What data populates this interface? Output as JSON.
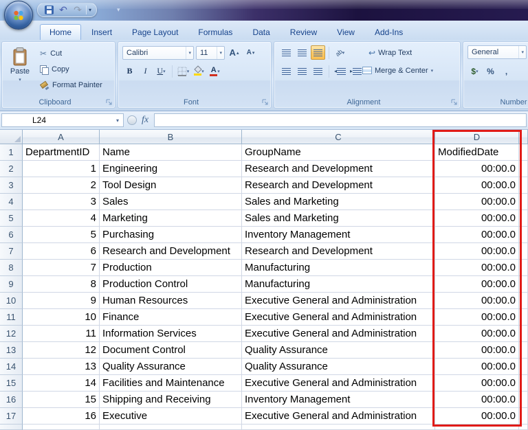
{
  "icons": {
    "dropdown": "▾",
    "undo": "↶",
    "redo": "↷",
    "scissors": "✂",
    "up_triangle": "▴",
    "down_triangle": "▾",
    "wrap_arrow": "↩",
    "orientation": "ab",
    "left_caret": "◂",
    "right_caret": "▸"
  },
  "ribbon": {
    "tabs": [
      {
        "label": "Home",
        "active": true
      },
      {
        "label": "Insert",
        "active": false
      },
      {
        "label": "Page Layout",
        "active": false
      },
      {
        "label": "Formulas",
        "active": false
      },
      {
        "label": "Data",
        "active": false
      },
      {
        "label": "Review",
        "active": false
      },
      {
        "label": "View",
        "active": false
      },
      {
        "label": "Add-Ins",
        "active": false
      }
    ],
    "clipboard": {
      "label": "Clipboard",
      "paste": "Paste",
      "cut": "Cut",
      "copy": "Copy",
      "format_painter": "Format Painter"
    },
    "font": {
      "label": "Font",
      "font_name": "Calibri",
      "font_size": "11",
      "bold": "B",
      "italic": "I",
      "underline": "U",
      "grow": "A",
      "shrink": "A",
      "color_letter": "A"
    },
    "alignment": {
      "label": "Alignment",
      "wrap_text": "Wrap Text",
      "merge_center": "Merge & Center"
    },
    "number": {
      "label": "Number",
      "format": "General",
      "currency": "$",
      "percent": "%",
      "comma": ","
    }
  },
  "formula_bar": {
    "name_box": "L24",
    "fx": "fx"
  },
  "grid": {
    "column_letters": [
      "A",
      "B",
      "C",
      "D"
    ],
    "highlighted_column": "D",
    "rows": [
      {
        "n": 1,
        "cells": [
          "DepartmentID",
          "Name",
          "GroupName",
          "ModifiedDate"
        ]
      },
      {
        "n": 2,
        "cells": [
          "1",
          "Engineering",
          "Research and Development",
          "00:00.0"
        ]
      },
      {
        "n": 3,
        "cells": [
          "2",
          "Tool Design",
          "Research and Development",
          "00:00.0"
        ]
      },
      {
        "n": 4,
        "cells": [
          "3",
          "Sales",
          "Sales and Marketing",
          "00:00.0"
        ]
      },
      {
        "n": 5,
        "cells": [
          "4",
          "Marketing",
          "Sales and Marketing",
          "00:00.0"
        ]
      },
      {
        "n": 6,
        "cells": [
          "5",
          "Purchasing",
          "Inventory Management",
          "00:00.0"
        ]
      },
      {
        "n": 7,
        "cells": [
          "6",
          "Research and Development",
          "Research and Development",
          "00:00.0"
        ]
      },
      {
        "n": 8,
        "cells": [
          "7",
          "Production",
          "Manufacturing",
          "00:00.0"
        ]
      },
      {
        "n": 9,
        "cells": [
          "8",
          "Production Control",
          "Manufacturing",
          "00:00.0"
        ]
      },
      {
        "n": 10,
        "cells": [
          "9",
          "Human Resources",
          "Executive General and Administration",
          "00:00.0"
        ]
      },
      {
        "n": 11,
        "cells": [
          "10",
          "Finance",
          "Executive General and Administration",
          "00:00.0"
        ]
      },
      {
        "n": 12,
        "cells": [
          "11",
          "Information Services",
          "Executive General and Administration",
          "00:00.0"
        ]
      },
      {
        "n": 13,
        "cells": [
          "12",
          "Document Control",
          "Quality Assurance",
          "00:00.0"
        ]
      },
      {
        "n": 14,
        "cells": [
          "13",
          "Quality Assurance",
          "Quality Assurance",
          "00:00.0"
        ]
      },
      {
        "n": 15,
        "cells": [
          "14",
          "Facilities and Maintenance",
          "Executive General and Administration",
          "00:00.0"
        ]
      },
      {
        "n": 16,
        "cells": [
          "15",
          "Shipping and Receiving",
          "Inventory Management",
          "00:00.0"
        ]
      },
      {
        "n": 17,
        "cells": [
          "16",
          "Executive",
          "Executive General and Administration",
          "00:00.0"
        ]
      }
    ]
  },
  "annotation": {
    "color": "#e11b17"
  }
}
